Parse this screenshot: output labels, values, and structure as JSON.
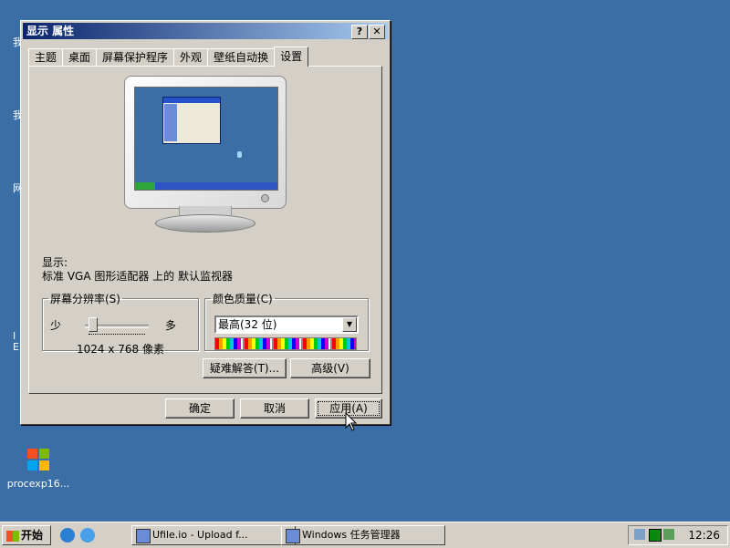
{
  "desktop": {
    "icons": [
      {
        "label": "procexp16...",
        "icon": "process-explorer-icon"
      }
    ],
    "fragments": [
      "我",
      "我",
      "网",
      "I",
      "E"
    ]
  },
  "dialog": {
    "title": "显示 属性",
    "help_btn": "?",
    "close_btn": "✕",
    "tabs": [
      "主题",
      "桌面",
      "屏幕保护程序",
      "外观",
      "壁纸自动换",
      "设置"
    ],
    "active_tab": "设置",
    "display_label": "显示:",
    "display_value": "标准 VGA 图形适配器 上的 默认监视器",
    "resolution": {
      "legend": "屏幕分辨率(S)",
      "less": "少",
      "more": "多",
      "value": "1024 x 768 像素"
    },
    "color_quality": {
      "legend": "颜色质量(C)",
      "selected": "最高(32 位)"
    },
    "buttons": {
      "troubleshoot": "疑难解答(T)...",
      "advanced": "高级(V)",
      "ok": "确定",
      "cancel": "取消",
      "apply": "应用(A)"
    }
  },
  "taskbar": {
    "start": "开始",
    "tasks": [
      {
        "label": "Ufile.io - Upload f..."
      },
      {
        "label": "Windows 任务管理器"
      }
    ],
    "clock": "12:26"
  }
}
